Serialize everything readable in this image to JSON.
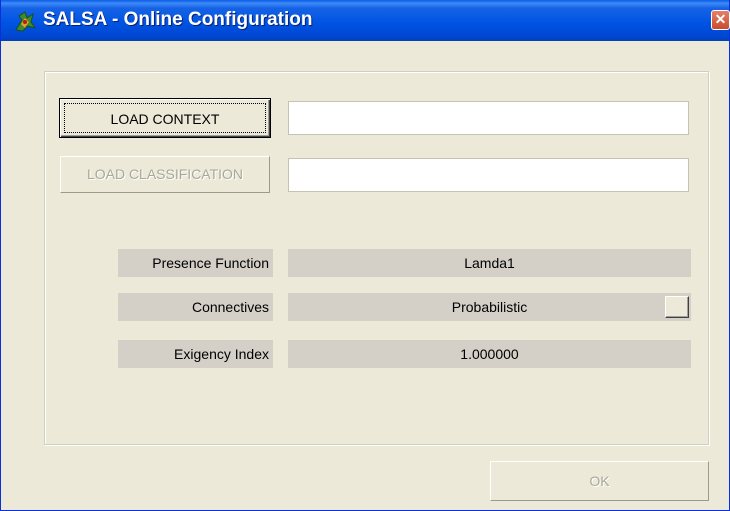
{
  "window": {
    "title": "SALSA - Online Configuration",
    "icon": "salsa-app-icon",
    "close_icon": "close-icon"
  },
  "buttons": {
    "load_context": "LOAD CONTEXT",
    "load_classification": "LOAD CLASSIFICATION",
    "ok": "OK"
  },
  "fields": {
    "context_path": "",
    "classification_path": ""
  },
  "settings": [
    {
      "label": "Presence Function",
      "value": "Lamda1"
    },
    {
      "label": "Connectives",
      "value": "Probabilistic"
    },
    {
      "label": "Exigency Index",
      "value": "1.000000"
    }
  ],
  "colors": {
    "titlebar": "#0054E3",
    "dialog_background": "#ECE9D8",
    "readout_background": "#D4D0C8",
    "disabled_text": "#A8A89A"
  }
}
